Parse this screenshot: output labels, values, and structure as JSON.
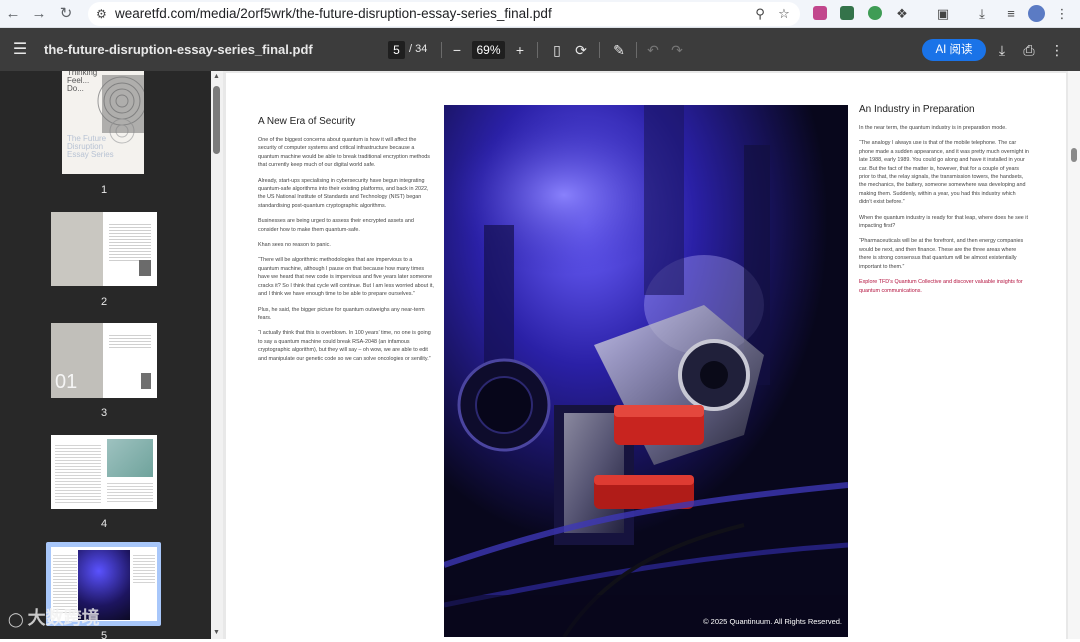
{
  "browser": {
    "url": "wearetfd.com/media/2orf5wrk/the-future-disruption-essay-series_final.pdf",
    "icons": [
      "back-icon",
      "forward-icon",
      "reload-icon",
      "tune-icon",
      "zoom-icon",
      "star-icon",
      "download-icon",
      "reading-list-icon",
      "profile-avatar"
    ]
  },
  "viewer": {
    "menu_icon": "hamburger-icon",
    "filename": "the-future-disruption-essay-series_final.pdf",
    "current_page": "5",
    "page_total": "/ 34",
    "zoom": "69%",
    "ai_button": "AI 阅读"
  },
  "thumbnails": [
    {
      "num": "1",
      "cover_text": "Thinking Feel... Do...",
      "series": "The Future Disruption Essay Series"
    },
    {
      "num": "2"
    },
    {
      "num": "3",
      "big": "01"
    },
    {
      "num": "4"
    },
    {
      "num": "5"
    }
  ],
  "document": {
    "left_title": "A New Era of Security",
    "left_paras": [
      "One of the biggest concerns about quantum is how it will affect the security of computer systems and critical infrastructure because a quantum machine would be able to break traditional encryption methods that currently keep much of our digital world safe.",
      "Already, start-ups specialising in cybersecurity have begun integrating quantum-safe algorithms into their existing platforms, and back in 2022, the US National Institute of Standards and Technology (NIST) began standardising post-quantum cryptographic algorithms.",
      "Businesses are being urged to assess their encrypted assets and consider how to make them quantum-safe.",
      "Khan sees no reason to panic.",
      "“There will be algorithmic methodologies that are impervious to a quantum machine, although I pause on that because how many times have we heard that new code is impervious and five years later someone cracks it? So I think that cycle will continue. But I am less worried about it, and I think we have enough time to be able to prepare ourselves.”",
      "Plus, he said, the bigger picture for quantum outweighs any near-term fears.",
      "“I actually think that this is overblown. In 100 years’ time, no one is going to say a quantum machine could break RSA-2048 (an infamous cryptographic algorithm), but they will say – oh wow, we are able to edit and manipulate our genetic code so we can solve oncologies or senility.”"
    ],
    "right_title": "An Industry in Preparation",
    "right_paras": [
      "In the near term, the quantum industry is in preparation mode.",
      "“The analogy I always use is that of the mobile telephone. The car phone made a sudden appearance, and it was pretty much overnight in late 1988, early 1989. You could go along and have it installed in your car. But the fact of the matter is, however, that for a couple of years prior to that, the relay signals, the transmission towers, the handsets, the mechanics, the battery, someone somewhere was developing and making them. Suddenly, within a year, you had this industry which didn’t exist before.”",
      "When the quantum industry is ready for that leap, where does he see it impacting first?",
      "“Pharmaceuticals will be at the forefront, and then energy companies would be next, and then finance. These are the three areas where there is strong consensus that quantum will be almost existentially important to them.”"
    ],
    "right_link": "Explore TFD’s Quantum Collective and discover valuable insights for quantum communications.",
    "photo_credit": "© 2025 Quantinuum. All Rights Reserved."
  },
  "watermark": "大数跨境",
  "colors": {
    "toolbar": "#3c3c3c",
    "sidebar": "#282828",
    "accent": "#1a73e8",
    "link": "#b3123e"
  }
}
